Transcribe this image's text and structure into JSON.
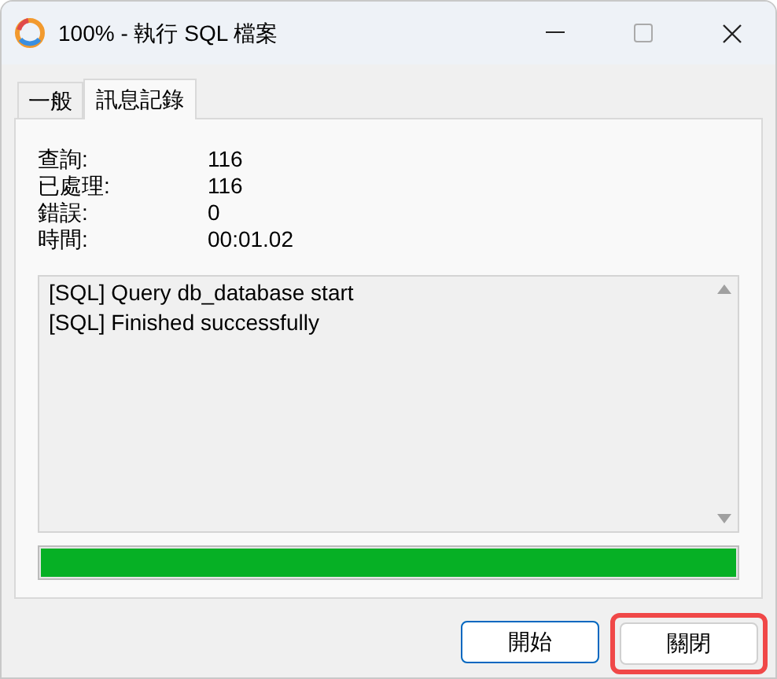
{
  "window": {
    "title": "100% - 執行 SQL 檔案"
  },
  "tabs": [
    {
      "label": "一般",
      "selected": false
    },
    {
      "label": "訊息記錄",
      "selected": true
    }
  ],
  "stats": [
    {
      "label": "查詢:",
      "value": "116"
    },
    {
      "label": "已處理:",
      "value": "116"
    },
    {
      "label": "錯誤:",
      "value": "0"
    },
    {
      "label": "時間:",
      "value": "00:01.02"
    }
  ],
  "log": [
    "[SQL] Query db_database start",
    "[SQL] Finished successfully"
  ],
  "progress": {
    "level": 1
  },
  "buttons": [
    {
      "label": "開始",
      "highlighted": false,
      "focused": true
    },
    {
      "label": "關閉",
      "highlighted": true,
      "focused": false
    }
  ]
}
